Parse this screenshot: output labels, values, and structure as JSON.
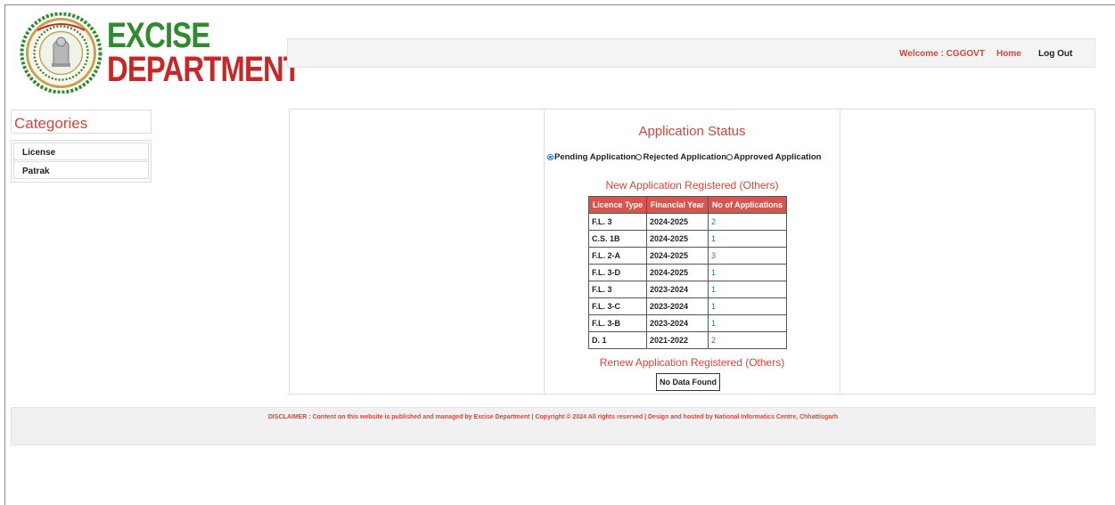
{
  "brand": {
    "line1": "EXCISE",
    "line2": "DEPARTMENT",
    "emblem_text": "सत्यमेव जयते",
    "colors": {
      "green": "#2e8b2e",
      "red": "#c62828"
    }
  },
  "topbar": {
    "welcome": "Welcome : CGGOVT",
    "home": "Home",
    "logout": "Log Out"
  },
  "sidebar": {
    "title": "Categories",
    "items": [
      {
        "label": "License"
      },
      {
        "label": "Patrak"
      }
    ]
  },
  "main": {
    "title": "Application Status",
    "radios": [
      {
        "label": "Pending Application",
        "checked": true
      },
      {
        "label": "Rejected Application",
        "checked": false
      },
      {
        "label": "Approved Application",
        "checked": false
      }
    ],
    "new_section_title": "New Application Registered (Others)",
    "table": {
      "headers": [
        "Licence Type",
        "Financial Year",
        "No of Applications"
      ],
      "rows": [
        [
          "F.L. 3",
          "2024-2025",
          "2"
        ],
        [
          "C.S. 1B",
          "2024-2025",
          "1"
        ],
        [
          "F.L. 2-A",
          "2024-2025",
          "3"
        ],
        [
          "F.L. 3-D",
          "2024-2025",
          "1"
        ],
        [
          "F.L. 3",
          "2023-2024",
          "1"
        ],
        [
          "F.L. 3-C",
          "2023-2024",
          "1"
        ],
        [
          "F.L. 3-B",
          "2023-2024",
          "1"
        ],
        [
          "D. 1",
          "2021-2022",
          "2"
        ]
      ]
    },
    "renew_section_title": "Renew Application Registered (Others)",
    "no_data": "No Data Found"
  },
  "footer": {
    "disclaimer": "DISCLAIMER : Content on this website is published and managed by Excise Department | Copyright © 2024 All rights reserved | Design and hosted by National Informatics Centre, Chhattisgarh"
  },
  "colors": {
    "accent": "#d2473c",
    "table_header": "#d9534f",
    "link": "#1a73e8"
  }
}
